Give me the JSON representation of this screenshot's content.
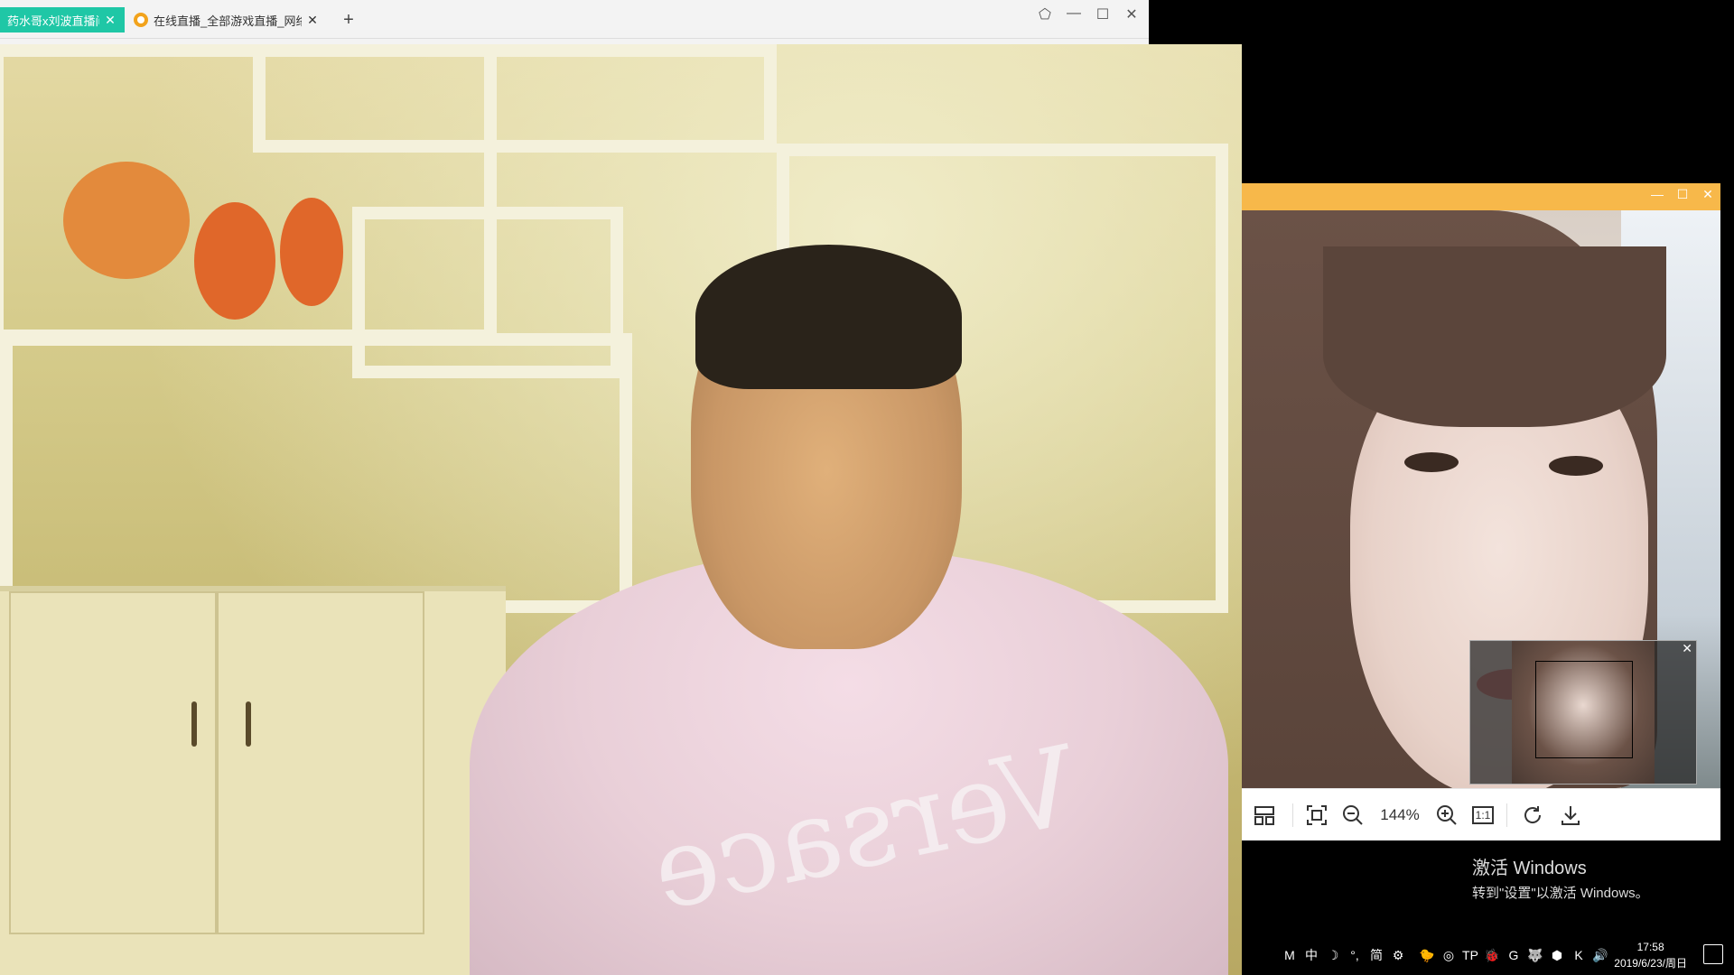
{
  "browser": {
    "tabs": [
      {
        "title": "药水哥x刘波直播间",
        "close": "✕"
      },
      {
        "title": "在线直播_全部游戏直播_网络游戏",
        "close": "✕"
      }
    ],
    "new_tab": "+",
    "controls": {
      "skin": "⬠",
      "minimize": "—",
      "maximize": "☐",
      "close": "✕"
    }
  },
  "video": {
    "shirt_text": "Versace"
  },
  "viewer": {
    "controls": {
      "minimize": "—",
      "maximize": "☐",
      "close": "✕"
    },
    "navigator_close": "✕",
    "zoom": "144%",
    "one_to_one": "1:1"
  },
  "watermark": {
    "line1": "激活 Windows",
    "line2": "转到\"设置\"以激活 Windows。"
  },
  "tray": {
    "icons": [
      "M",
      "中",
      "☽",
      "°,",
      "简",
      "⚙"
    ],
    "app_icons": [
      "🐤",
      "◎",
      "TP",
      "🐞",
      "G",
      "🐺",
      "⬢",
      "K",
      "🔊"
    ],
    "time": "17:58",
    "date": "2019/6/23/周日"
  }
}
